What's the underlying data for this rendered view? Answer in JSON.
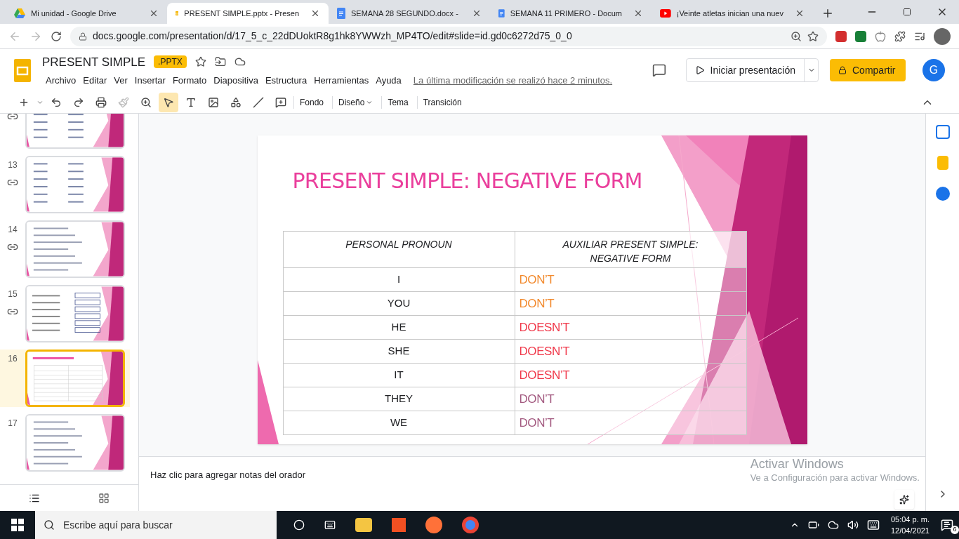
{
  "browser": {
    "tabs": [
      {
        "title": "Mi unidad - Google Drive",
        "kind": "drive",
        "selected": false
      },
      {
        "title": "PRESENT SIMPLE.pptx - Presen",
        "kind": "slides",
        "selected": true
      },
      {
        "title": "SEMANA 28 SEGUNDO.docx -",
        "kind": "docs",
        "selected": false
      },
      {
        "title": "SEMANA 11 PRIMERO - Docum",
        "kind": "docs",
        "selected": false
      },
      {
        "title": "¡Veinte atletas inician una nuev",
        "kind": "youtube",
        "selected": false
      }
    ],
    "address": "docs.google.com/presentation/d/17_5_c_22dDUoktR8g1hk8YWWzh_MP4TO/edit#slide=id.gd0c6272d75_0_0"
  },
  "app": {
    "title": "PRESENT SIMPLE",
    "badge": ".PPTX",
    "menu": [
      "Archivo",
      "Editar",
      "Ver",
      "Insertar",
      "Formato",
      "Diapositiva",
      "Estructura",
      "Herramientas",
      "Ayuda"
    ],
    "last_edit": "La última modificación se realizó hace 2 minutos.",
    "present_button": "Iniciar presentación",
    "share_button": "Compartir",
    "avatar": "G"
  },
  "toolbar": {
    "text_buttons": [
      {
        "label": "Fondo",
        "menu": false
      },
      {
        "label": "Diseño",
        "menu": true
      },
      {
        "label": "Tema",
        "menu": false
      },
      {
        "label": "Transición",
        "menu": false
      }
    ]
  },
  "filmstrip": [
    {
      "linked": true,
      "selected": false,
      "kind": "list"
    },
    {
      "number": "13",
      "linked": true,
      "selected": false,
      "kind": "list"
    },
    {
      "number": "14",
      "linked": true,
      "selected": false,
      "kind": "lines"
    },
    {
      "number": "15",
      "linked": true,
      "selected": false,
      "kind": "boxes"
    },
    {
      "number": "16",
      "linked": false,
      "selected": true,
      "kind": "table"
    },
    {
      "number": "17",
      "linked": false,
      "selected": false,
      "kind": "lines"
    }
  ],
  "slide": {
    "title": "PRESENT SIMPLE: NEGATIVE FORM",
    "columns": [
      "PERSONAL PRONOUN",
      "AUXILIAR PRESENT SIMPLE: NEGATIVE FORM"
    ],
    "rows": [
      {
        "pronoun": "I",
        "auxiliary": "DON’T",
        "color": "#f28a2e"
      },
      {
        "pronoun": "YOU",
        "auxiliary": "DON’T",
        "color": "#f28a2e"
      },
      {
        "pronoun": "HE",
        "auxiliary": "DOESN’T",
        "color": "#f0384a"
      },
      {
        "pronoun": "SHE",
        "auxiliary": "DOESN’T",
        "color": "#f0384a"
      },
      {
        "pronoun": "IT",
        "auxiliary": "DOESN’T",
        "color": "#f0384a"
      },
      {
        "pronoun": "THEY",
        "auxiliary": "DON’T",
        "color": "#a35a80"
      },
      {
        "pronoun": "WE",
        "auxiliary": "DON’T",
        "color": "#a35a80"
      }
    ]
  },
  "notes": {
    "placeholder": "Haz clic para agregar notas del orador"
  },
  "activation": {
    "title": "Activar Windows",
    "subtitle": "Ve a Configuración para activar Windows."
  },
  "taskbar": {
    "search_placeholder": "Escribe aquí para buscar",
    "time": "05:04 p. m.",
    "date": "12/04/2021",
    "notifications": "6"
  }
}
